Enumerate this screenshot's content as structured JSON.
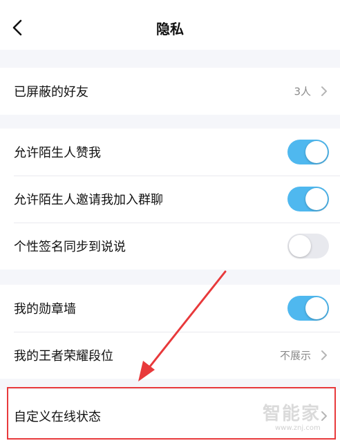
{
  "header": {
    "title": "隐私"
  },
  "rows": {
    "blocked": {
      "label": "已屏蔽的好友",
      "value": "3人"
    },
    "stranger_like": {
      "label": "允许陌生人赞我",
      "toggle": "on"
    },
    "stranger_invite": {
      "label": "允许陌生人邀请我加入群聊",
      "toggle": "on"
    },
    "signature_sync": {
      "label": "个性签名同步到说说",
      "toggle": "off"
    },
    "medal_wall": {
      "label": "我的勋章墙",
      "toggle": "on"
    },
    "honor_rank": {
      "label": "我的王者荣耀段位",
      "value": "不展示"
    },
    "custom_status": {
      "label": "自定义在线状态"
    }
  },
  "watermark": {
    "text": "智能家",
    "url": "www.znj.com"
  },
  "colors": {
    "toggle_on": "#4fb8ef",
    "toggle_off": "#e8e9ee",
    "highlight": "#e8393b"
  }
}
